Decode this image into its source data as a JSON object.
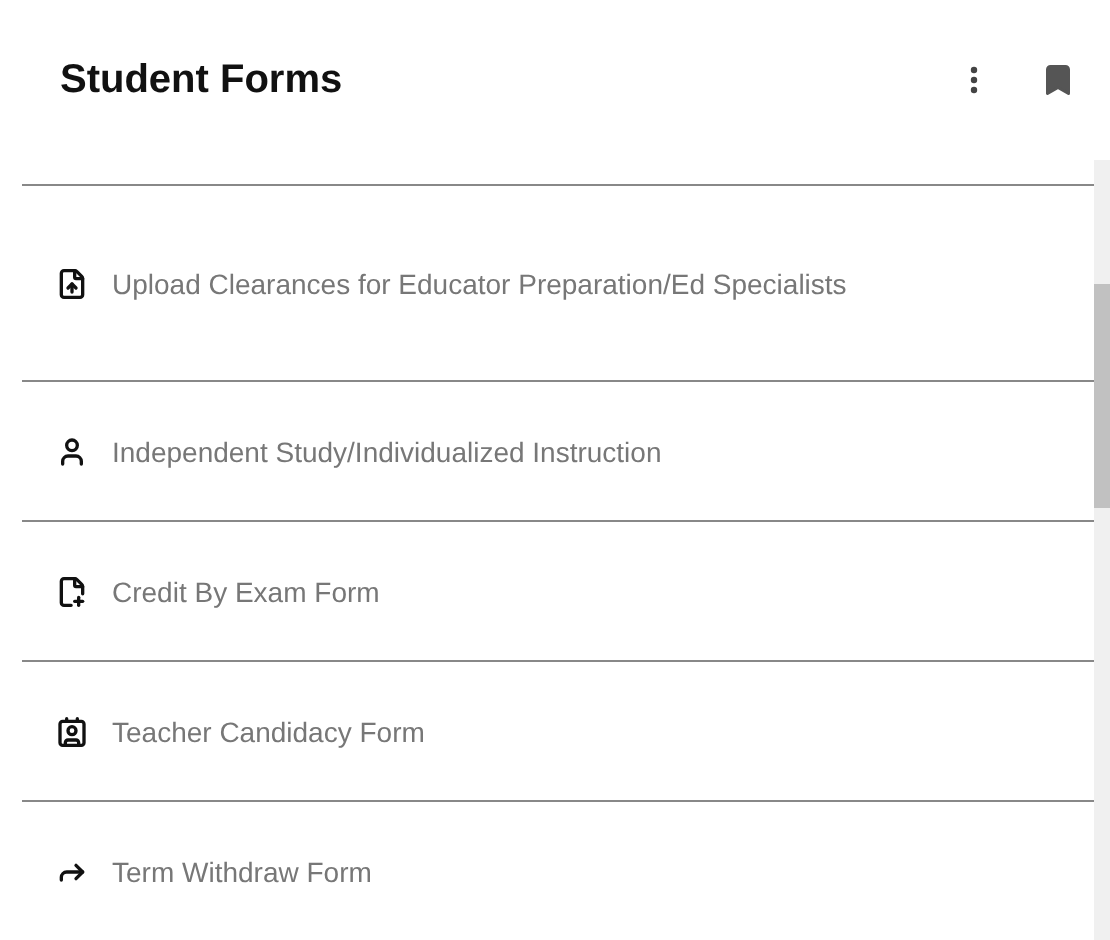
{
  "header": {
    "title": "Student Forms"
  },
  "forms": [
    {
      "kind": "upload",
      "label": "Upload Clearances for Educator Preparation/Ed Specialists"
    },
    {
      "kind": "person",
      "label": "Independent Study/Individualized Instruction"
    },
    {
      "kind": "exam",
      "label": "Credit By Exam Form"
    },
    {
      "kind": "candidacy",
      "label": "Teacher Candidacy Form"
    },
    {
      "kind": "withdraw",
      "label": "Term Withdraw Form"
    }
  ]
}
